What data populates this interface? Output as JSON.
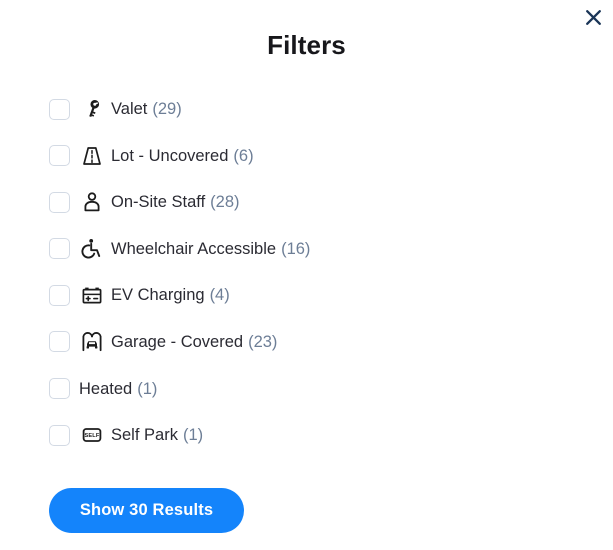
{
  "modal": {
    "title": "Filters",
    "close_label": "Close",
    "close_icon": "close-icon"
  },
  "colors": {
    "accent": "#1484fb",
    "close_icon": "#1a3557",
    "label_text": "#2b2b33",
    "count_text": "#6d7e96",
    "checkbox_border": "#d3dae4",
    "icon": "#1c1c1c"
  },
  "filters": [
    {
      "label": "Valet",
      "count": "(29)",
      "icon": "key-icon",
      "checked": false
    },
    {
      "label": "Lot - Uncovered",
      "count": "(6)",
      "icon": "road-icon",
      "checked": false
    },
    {
      "label": "On-Site Staff",
      "count": "(28)",
      "icon": "person-icon",
      "checked": false
    },
    {
      "label": "Wheelchair Accessible",
      "count": "(16)",
      "icon": "wheelchair-icon",
      "checked": false
    },
    {
      "label": "EV Charging",
      "count": "(4)",
      "icon": "battery-icon",
      "checked": false
    },
    {
      "label": "Garage - Covered",
      "count": "(23)",
      "icon": "garage-car-icon",
      "checked": false
    },
    {
      "label": "Heated",
      "count": "(1)",
      "icon": "",
      "checked": false
    },
    {
      "label": "Self Park",
      "count": "(1)",
      "icon": "self-park-icon",
      "checked": false
    }
  ],
  "cta": {
    "label": "Show 30 Results"
  }
}
